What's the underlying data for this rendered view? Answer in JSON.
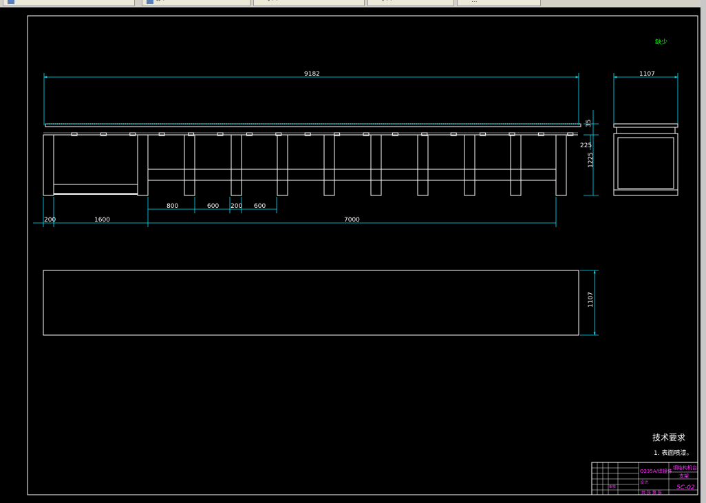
{
  "tabs": [
    {
      "label": "",
      "icon": "drawing-icon"
    },
    {
      "label": "-- ·",
      "icon": "window-icon"
    },
    {
      "label": "- · ·",
      "icon": "window-icon"
    },
    {
      "label": "- · ·",
      "icon": "window-icon"
    },
    {
      "label": "...",
      "icon": "window-icon"
    }
  ],
  "drawing": {
    "corner_note": "缺少",
    "dimensions": {
      "overall_length": "9182",
      "end_width": "1107",
      "top_gap": "35",
      "beam_depth": "225",
      "total_height": "1225",
      "bay_1": "800",
      "bay_2": "600",
      "post_gap": "200",
      "bay_3": "600",
      "left_offset": "200",
      "left_span": "1600",
      "main_span": "7000",
      "plan_width": "1107"
    },
    "tech_requirements": {
      "heading": "技术要求",
      "item_1": "1. 表面喷漆。"
    },
    "title_block": {
      "material": "Q235A/焊接件",
      "drawing_title": "钢结构机台",
      "part_name": "支架",
      "drawing_number": "5C-02",
      "label_a": "设计",
      "label_b": "审核",
      "footer": "共 张 第 张"
    },
    "colors": {
      "outline": "#ffffff",
      "dimension": "#00e5ff",
      "note": "#00ff00",
      "title_block_text": "#ff33ff"
    }
  }
}
